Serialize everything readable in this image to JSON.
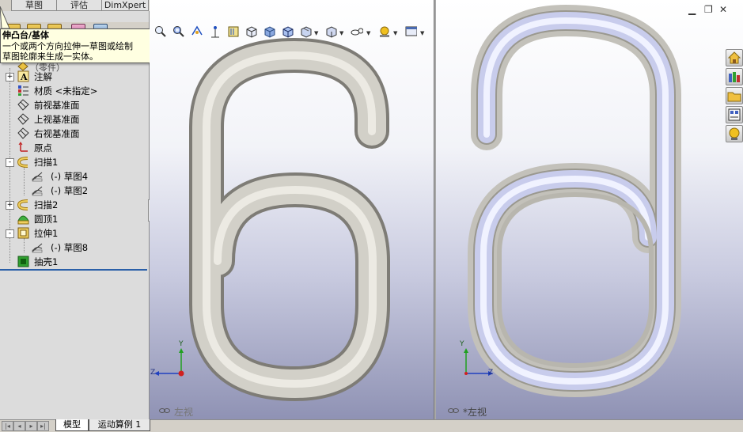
{
  "command_tabs": [
    "草图",
    "评估",
    "DimXpert"
  ],
  "tooltip": {
    "title": "伸凸台/基体",
    "lines": [
      "一个或两个方向拉伸一草图或绘制",
      "草图轮廓来生成一实体。"
    ]
  },
  "tree": {
    "root_fragment": "（零件）",
    "items": [
      {
        "label": "注解",
        "expander": "+",
        "icon": "annotation-icon"
      },
      {
        "label": "材质 <未指定>",
        "expander": "",
        "icon": "material-icon"
      },
      {
        "label": "前视基准面",
        "expander": "",
        "icon": "plane-icon"
      },
      {
        "label": "上视基准面",
        "expander": "",
        "icon": "plane-icon"
      },
      {
        "label": "右视基准面",
        "expander": "",
        "icon": "plane-icon"
      },
      {
        "label": "原点",
        "expander": "",
        "icon": "origin-icon"
      },
      {
        "label": "扫描1",
        "expander": "-",
        "icon": "sweep-icon"
      },
      {
        "label": "(-) 草图4",
        "expander": "",
        "icon": "sketch-icon"
      },
      {
        "label": "(-) 草图2",
        "expander": "",
        "icon": "sketch-icon"
      },
      {
        "label": "扫描2",
        "expander": "+",
        "icon": "sweep-icon"
      },
      {
        "label": "圆顶1",
        "expander": "",
        "icon": "dome-icon"
      },
      {
        "label": "拉伸1",
        "expander": "-",
        "icon": "extrude-icon"
      },
      {
        "label": "(-) 草图8",
        "expander": "",
        "icon": "sketch-icon"
      },
      {
        "label": "抽壳1",
        "expander": "",
        "icon": "shell-icon"
      }
    ]
  },
  "bottom_tabs": [
    "模型",
    "运动算例 1"
  ],
  "viewports": {
    "left": {
      "label": "左视"
    },
    "right": {
      "label": "*左视"
    }
  },
  "axis_labels": {
    "y": "Y",
    "z": "Z"
  },
  "colors": {
    "accent": "#2a5fa8",
    "part_gray": "#c8c6bf",
    "part_blue": "#d4d8f4",
    "tooltip_bg": "#ffffe1"
  }
}
